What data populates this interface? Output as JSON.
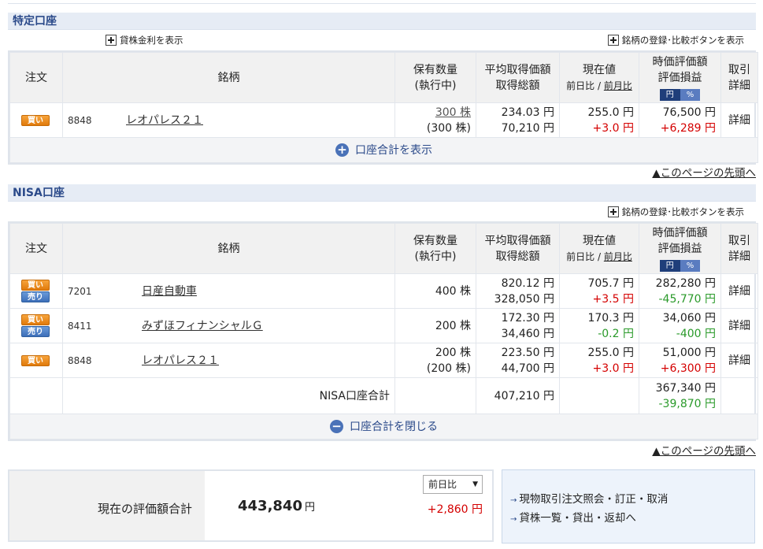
{
  "sections": {
    "tokutei": {
      "title": "特定口座",
      "lending_rate_option": "貸株金利を表示",
      "register_compare_option": "銘柄の登録･比較ボタンを表示",
      "expand_label": "口座合計を表示"
    },
    "nisa": {
      "title": "NISA口座",
      "register_compare_option": "銘柄の登録･比較ボタンを表示",
      "total_label": "NISA口座合計",
      "total_cost": "407,210 円",
      "total_value": "367,340 円",
      "total_pl": "-39,870 円",
      "collapse_label": "口座合計を閉じる"
    }
  },
  "headers": {
    "order": "注文",
    "name": "銘柄",
    "qty1": "保有数量",
    "qty2": "(執行中)",
    "avg1": "平均取得価額",
    "avg2": "取得総額",
    "cur1": "現在値",
    "cur_day": "前日比",
    "cur_sep": " / ",
    "cur_month": "前月比",
    "val1": "時価評価額",
    "val2": "評価損益",
    "toggle_yen": "円",
    "toggle_pct": "%",
    "det1": "取引",
    "det2": "詳細"
  },
  "badges": {
    "buy": "買い",
    "sell": "売り"
  },
  "tokutei_rows": [
    {
      "code": "8848",
      "name": "レオパレス２１",
      "qty": "300 株",
      "pending": "(300 株)",
      "avg_price": "234.03 円",
      "cost": "70,210 円",
      "current": "255.0 円",
      "change": "+3.0 円",
      "value": "76,500 円",
      "pl": "+6,289 円",
      "detail": "詳細"
    }
  ],
  "nisa_rows": [
    {
      "code": "7201",
      "name": "日産自動車",
      "qty": "400 株",
      "pending": "",
      "avg_price": "820.12 円",
      "cost": "328,050 円",
      "current": "705.7 円",
      "change": "+3.5 円",
      "value": "282,280 円",
      "pl": "-45,770 円",
      "detail": "詳細"
    },
    {
      "code": "8411",
      "name": "みずほフィナンシャルＧ",
      "qty": "200 株",
      "pending": "",
      "avg_price": "172.30 円",
      "cost": "34,460 円",
      "current": "170.3 円",
      "change": "-0.2 円",
      "value": "34,060 円",
      "pl": "-400 円",
      "detail": "詳細"
    },
    {
      "code": "8848",
      "name": "レオパレス２１",
      "qty": "200 株",
      "pending": "(200 株)",
      "avg_price": "223.50 円",
      "cost": "44,700 円",
      "current": "255.0 円",
      "change": "+3.0 円",
      "value": "51,000 円",
      "pl": "+6,300 円",
      "detail": "詳細"
    }
  ],
  "page_top": "▲このページの先頭へ",
  "summary": {
    "label": "現在の評価額合計",
    "amount": "443,840",
    "unit": "円",
    "select_value": "前日比",
    "change": "+2,860 円"
  },
  "links": [
    "現物取引注文照会・訂正・取消",
    "貸株一覧・貸出・返却へ"
  ],
  "colors": {
    "positive": "#d40000",
    "negative": "#2a9a2a",
    "header_text": "#2b4a8a",
    "buy_badge": "#f39a2e",
    "sell_badge": "#4d7fc6"
  }
}
